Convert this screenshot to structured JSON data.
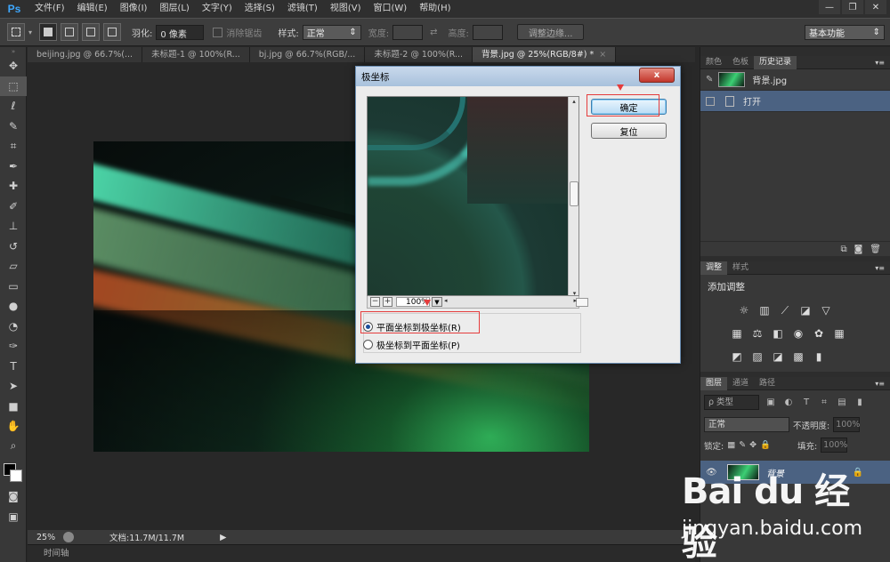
{
  "app": {
    "logo": "Ps"
  },
  "menu": [
    "文件(F)",
    "编辑(E)",
    "图像(I)",
    "图层(L)",
    "文字(Y)",
    "选择(S)",
    "滤镜(T)",
    "视图(V)",
    "窗口(W)",
    "帮助(H)"
  ],
  "options": {
    "feather_label": "羽化:",
    "feather_value": "0 像素",
    "antialias_label": "消除锯齿",
    "style_label": "样式:",
    "style_value": "正常",
    "width_label": "宽度:",
    "height_label": "高度:",
    "refine_edge": "调整边缘...",
    "workspace": "基本功能"
  },
  "doc_tabs": [
    {
      "label": "beijing.jpg @ 66.7%(...",
      "active": false
    },
    {
      "label": "未标题-1 @ 100%(R...",
      "active": false
    },
    {
      "label": "bj.jpg @ 66.7%(RGB/...",
      "active": false
    },
    {
      "label": "未标题-2 @ 100%(R...",
      "active": false
    },
    {
      "label": "背景.jpg @ 25%(RGB/8#) *",
      "active": true
    }
  ],
  "status": {
    "zoom": "25%",
    "doc": "文档:11.7M/11.7M"
  },
  "timeline": "时间轴",
  "dialog": {
    "title": "极坐标",
    "close": "x",
    "ok": "确定",
    "reset": "复位",
    "zoom_value": "100%",
    "option_rect_to_polar": "平面坐标到极坐标(R)",
    "option_polar_to_rect": "极坐标到平面坐标(P)",
    "selected_option": "rect_to_polar"
  },
  "panels": {
    "top_tabs": [
      "颜色",
      "色板",
      "历史记录"
    ],
    "history": [
      {
        "label": "背景.jpg"
      },
      {
        "label": "打开"
      }
    ],
    "adjust_tabs": [
      "调整",
      "样式"
    ],
    "adjust_title": "添加调整",
    "layers_tabs": [
      "图层",
      "通道",
      "路径"
    ],
    "layers_filter": "ρ 类型",
    "blend_mode": "正常",
    "opacity_label": "不透明度:",
    "opacity_value": "100%",
    "lock_label": "锁定:",
    "fill_label": "填充:",
    "fill_value": "100%",
    "layer_name": "背景"
  },
  "watermark": {
    "brand": "Bai du 经验",
    "url": "jingyan.baidu.com"
  }
}
